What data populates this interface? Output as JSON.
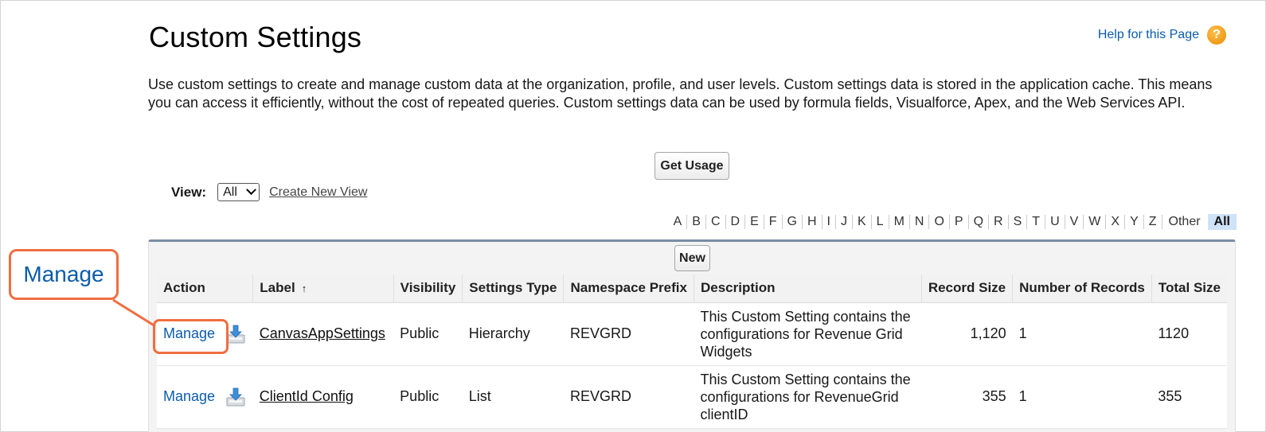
{
  "page": {
    "title": "Custom Settings",
    "help_label": "Help for this Page",
    "help_icon": "?",
    "intro": "Use custom settings to create and manage custom data at the organization, profile, and user levels. Custom settings data is stored in the application cache. This means you can access it efficiently, without the cost of repeated queries. Custom settings data can be used by formula fields, Visualforce, Apex, and the Web Services API."
  },
  "actions": {
    "get_usage": "Get Usage",
    "new": "New"
  },
  "view": {
    "label": "View:",
    "selected": "All",
    "create_new": "Create New View"
  },
  "alphabet": {
    "letters": [
      "A",
      "B",
      "C",
      "D",
      "E",
      "F",
      "G",
      "H",
      "I",
      "J",
      "K",
      "L",
      "M",
      "N",
      "O",
      "P",
      "Q",
      "R",
      "S",
      "T",
      "U",
      "V",
      "W",
      "X",
      "Y",
      "Z"
    ],
    "other": "Other",
    "all": "All"
  },
  "table": {
    "headers": {
      "action": "Action",
      "label": "Label",
      "sort_indicator": "↑",
      "visibility": "Visibility",
      "settings_type": "Settings Type",
      "namespace_prefix": "Namespace Prefix",
      "description": "Description",
      "record_size": "Record Size",
      "number_of_records": "Number of Records",
      "total_size": "Total Size"
    },
    "rows": [
      {
        "action": "Manage",
        "label": "CanvasAppSettings",
        "visibility": "Public",
        "settings_type": "Hierarchy",
        "namespace_prefix": "REVGRD",
        "description": "This Custom Setting contains the configurations for Revenue Grid Widgets",
        "record_size": "1,120",
        "number_of_records": "1",
        "total_size": "1120"
      },
      {
        "action": "Manage",
        "label": "ClientId Config",
        "visibility": "Public",
        "settings_type": "List",
        "namespace_prefix": "REVGRD",
        "description": "This Custom Setting contains the configurations for RevenueGrid clientID",
        "record_size": "355",
        "number_of_records": "1",
        "total_size": "355"
      }
    ]
  },
  "callout": {
    "text": "Manage"
  },
  "colors": {
    "accent_orange": "#f06e40",
    "link_blue": "#0b5cab",
    "panel_border": "#7b8da3",
    "all_highlight": "#cfe3f8"
  },
  "icons": {
    "help": "help-icon",
    "download": "download-icon"
  }
}
